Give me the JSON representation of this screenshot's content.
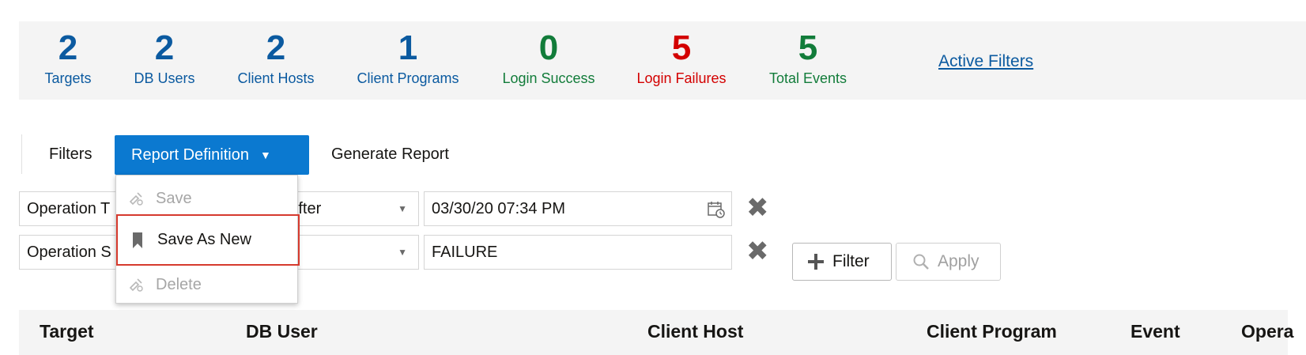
{
  "stats": [
    {
      "value": "2",
      "label": "Targets",
      "color": "#0b5aa0"
    },
    {
      "value": "2",
      "label": "DB Users",
      "color": "#0b5aa0"
    },
    {
      "value": "2",
      "label": "Client Hosts",
      "color": "#0b5aa0"
    },
    {
      "value": "1",
      "label": "Client Programs",
      "color": "#0b5aa0"
    },
    {
      "value": "0",
      "label": "Login Success",
      "color": "#127c3a"
    },
    {
      "value": "5",
      "label": "Login Failures",
      "color": "#d30000"
    },
    {
      "value": "5",
      "label": "Total Events",
      "color": "#127c3a"
    }
  ],
  "active_filters_link": "Active Filters",
  "tabs": {
    "filters": "Filters",
    "report_definition": "Report Definition",
    "generate_report": "Generate Report"
  },
  "filter_rows": [
    {
      "field": "Operation T",
      "operator": "After",
      "value": "03/30/20 07:34 PM"
    },
    {
      "field": "Operation S",
      "operator": "",
      "value": "FAILURE"
    }
  ],
  "buttons": {
    "add_filter": "Filter",
    "apply": "Apply"
  },
  "menu": {
    "save": "Save",
    "save_as_new": "Save As New",
    "delete": "Delete"
  },
  "table": {
    "columns": [
      "Target",
      "DB User",
      "Client Host",
      "Client Program",
      "Event",
      "Opera"
    ]
  },
  "icons": {
    "calendar": "calendar-icon",
    "clear": "close-icon",
    "plus": "plus-icon",
    "search": "search-icon",
    "bookmark": "bookmark-icon",
    "caret": "caret-down-icon"
  }
}
